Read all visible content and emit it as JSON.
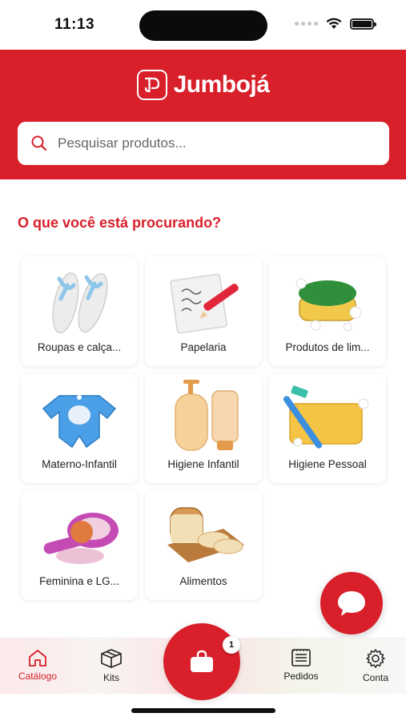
{
  "status_bar": {
    "time": "11:13"
  },
  "header": {
    "brand": "Jumbojá",
    "search_placeholder": "Pesquisar produtos..."
  },
  "section_title": "O que você está procurando?",
  "categories": [
    {
      "label": "Roupas e calça...",
      "icon": "flip-flops"
    },
    {
      "label": "Papelaria",
      "icon": "paper-pencil"
    },
    {
      "label": "Produtos de lim...",
      "icon": "cleaning-sponge"
    },
    {
      "label": "Materno-Infantil",
      "icon": "baby-clothes"
    },
    {
      "label": "Higiene Infantil",
      "icon": "lotion-bottles"
    },
    {
      "label": "Higiene Pessoal",
      "icon": "razor-soap"
    },
    {
      "label": "Feminina e LG...",
      "icon": "makeup-compact"
    },
    {
      "label": "Alimentos",
      "icon": "bread"
    }
  ],
  "bottom_nav": {
    "catalog": "Catálogo",
    "kits": "Kits",
    "orders": "Pedidos",
    "account": "Conta",
    "cart_count": "1"
  },
  "colors": {
    "brand": "#d81f2a"
  }
}
